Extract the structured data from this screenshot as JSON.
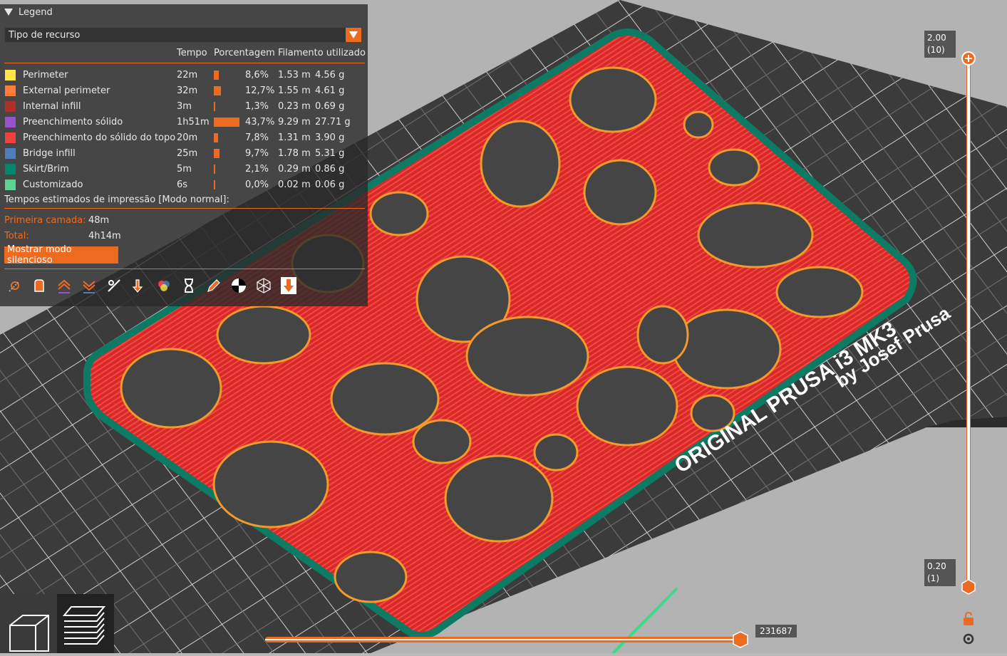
{
  "legend": {
    "title": "Legend",
    "view_type": "Tipo de recurso",
    "columns": [
      "Tempo",
      "Porcentagem",
      "Filamento utilizado"
    ],
    "rows": [
      {
        "name": "Perimeter",
        "color": "#ffe646",
        "time": "22m",
        "percent": "8,6%",
        "percent_value": 8.6,
        "length": "1.53 m",
        "weight": "4.56 g"
      },
      {
        "name": "External perimeter",
        "color": "#ff7d38",
        "time": "32m",
        "percent": "12,7%",
        "percent_value": 12.7,
        "length": "1.55 m",
        "weight": "4.61 g"
      },
      {
        "name": "Internal infill",
        "color": "#b03029",
        "time": "3m",
        "percent": "1,3%",
        "percent_value": 1.3,
        "length": "0.23 m",
        "weight": "0.69 g"
      },
      {
        "name": "Preenchimento sólido",
        "color": "#9654cc",
        "time": "1h51m",
        "percent": "43,7%",
        "percent_value": 43.7,
        "length": "9.29 m",
        "weight": "27.71 g"
      },
      {
        "name": "Preenchimento do sólido do topo",
        "color": "#f04040",
        "time": "20m",
        "percent": "7,8%",
        "percent_value": 7.8,
        "length": "1.31 m",
        "weight": "3.90 g"
      },
      {
        "name": "Bridge infill",
        "color": "#4d80ba",
        "time": "25m",
        "percent": "9,7%",
        "percent_value": 9.7,
        "length": "1.78 m",
        "weight": "5.31 g"
      },
      {
        "name": "Skirt/Brim",
        "color": "#00876e",
        "time": "5m",
        "percent": "2,1%",
        "percent_value": 2.1,
        "length": "0.29 m",
        "weight": "0.86 g"
      },
      {
        "name": "Customizado",
        "color": "#5ed194",
        "time": "6s",
        "percent": "0,0%",
        "percent_value": 0.0,
        "length": "0.02 m",
        "weight": "0.06 g"
      }
    ],
    "estimated_title": "Tempos estimados de impressão [Modo normal]:",
    "first_layer_label": "Primeira camada:",
    "first_layer_value": "48m",
    "total_label": "Total:",
    "total_value": "4h14m",
    "silent_button": "Mostrar modo silencioso",
    "toolbar_icons": [
      "travel-icon",
      "retractions-icon",
      "deretractions-icon",
      "wipe-icon",
      "seams-icon",
      "tool-changes-icon",
      "color-changes-icon",
      "pause-icon",
      "custom-gcode-icon",
      "center-of-gravity-icon",
      "shells-icon",
      "tool-marker-icon"
    ]
  },
  "layer_slider": {
    "top_value": "2.00",
    "top_layer": "(10)",
    "bottom_value": "0.20",
    "bottom_layer": "(1)"
  },
  "move_slider": {
    "value": "231687"
  },
  "bed_text": {
    "line1": "ORIGINAL PRUSA i3 MK3",
    "line2": "by Josef Prusa"
  },
  "colors": {
    "accent": "#ed6b21",
    "brim": "#00876e",
    "top_infill": "#e8302a"
  }
}
